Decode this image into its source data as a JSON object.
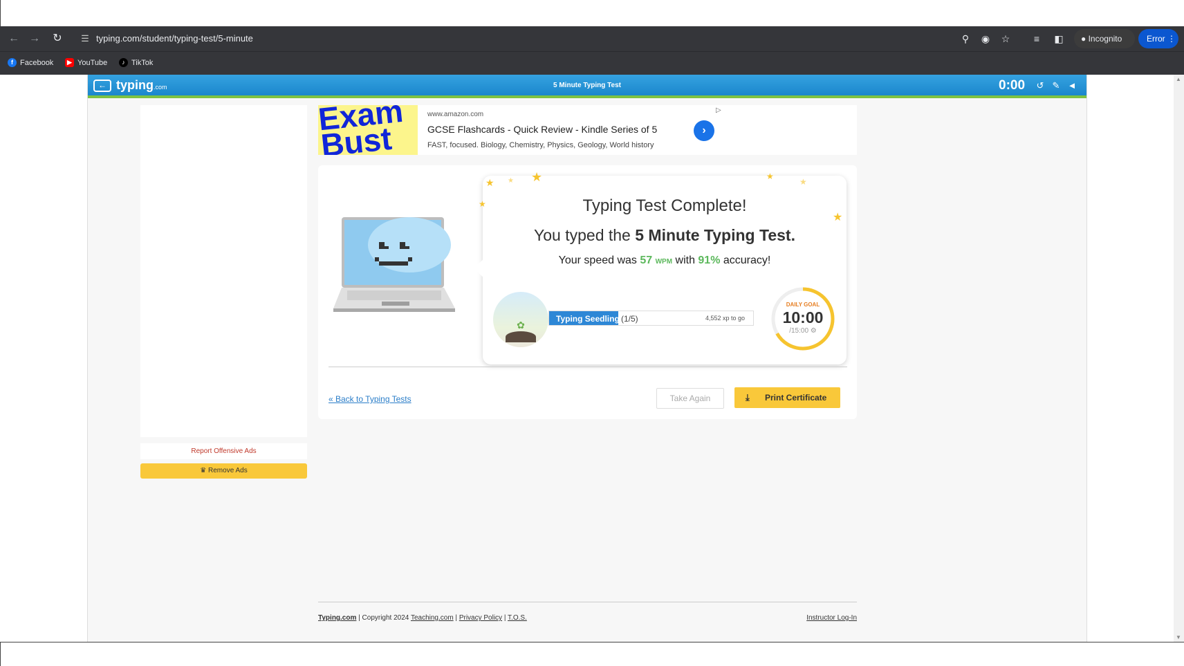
{
  "browser": {
    "url": "typing.com/student/typing-test/5-minute",
    "incognito_label": "Incognito",
    "error_label": "Error",
    "bookmarks": [
      {
        "label": "Facebook",
        "icon": "facebook-icon",
        "color": "#1877f2"
      },
      {
        "label": "YouTube",
        "icon": "youtube-icon",
        "color": "#ff0000"
      },
      {
        "label": "TikTok",
        "icon": "tiktok-icon",
        "color": "#000000"
      }
    ]
  },
  "header": {
    "logo": "typing",
    "logo_suffix": ".com",
    "title": "5 Minute Typing Test",
    "timer": "0:00"
  },
  "sidebar": {
    "report_ads": "Report Offensive Ads",
    "remove_ads": "♛ Remove Ads"
  },
  "ad": {
    "image_text": "Exam Bust",
    "domain": "www.amazon.com",
    "title": "GCSE Flashcards - Quick Review - Kindle Series of 5",
    "description": "FAST, focused. Biology, Chemistry, Physics, Geology, World history"
  },
  "results": {
    "title": "Typing Test Complete!",
    "typed_prefix": "You typed the ",
    "test_name": "5 Minute Typing Test.",
    "speed_prefix": "Your speed was ",
    "wpm_value": "57",
    "wpm_unit": "WPM",
    "speed_mid": " with ",
    "accuracy": "91%",
    "speed_suffix": " accuracy!",
    "level_name": "Typing Seedling",
    "level_count": "(1/5)",
    "level_progress": 0.34,
    "xp_to_go": "4,552 xp to go",
    "goal_label": "DAILY GOAL",
    "goal_time": "10:00",
    "goal_total": "/15:00 ⚙",
    "goal_progress": 0.6667,
    "back_link": "« Back to Typing Tests",
    "take_again": "Take Again",
    "print_certificate": "Print Certificate"
  },
  "footer": {
    "brand": "Typing.com",
    "copyright": " | Copyright 2024 ",
    "teaching": "Teaching.com",
    "sep1": " | ",
    "privacy": "Privacy Policy",
    "sep2": " | ",
    "tos": "T.O.S.",
    "instructor_login": "Instructor Log-In"
  },
  "colors": {
    "header_blue": "#1b87cc",
    "accent_green": "#5cb85c",
    "button_yellow": "#f9c83a",
    "progress_blue": "#2d87d6",
    "goal_ring": "#f6c42f"
  }
}
